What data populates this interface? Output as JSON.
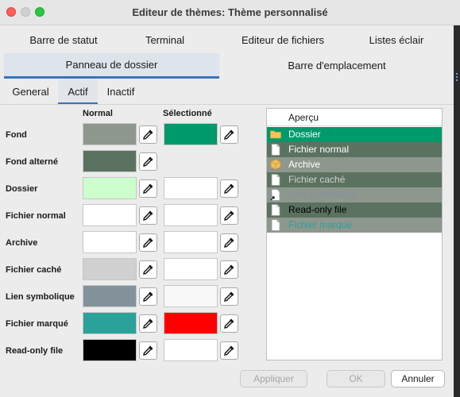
{
  "window": {
    "title": "Editeur de thèmes: Thème personnalisé"
  },
  "tabs_row1": [
    "Barre de statut",
    "Terminal",
    "Editeur de fichiers",
    "Listes éclair"
  ],
  "tabs_row2": [
    "Panneau de dossier",
    "Barre d'emplacement"
  ],
  "subtabs": [
    "General",
    "Actif",
    "Inactif"
  ],
  "columns": {
    "normal": "Normal",
    "selected": "Sélectionné"
  },
  "rows": [
    {
      "label": "Fond",
      "normal": "#8e978e",
      "selected": "#00996b"
    },
    {
      "label": "Fond alterné",
      "normal": "#5b7261",
      "selected": null
    },
    {
      "label": "Dossier",
      "normal": "#ccffcc",
      "selected": "#ffffff"
    },
    {
      "label": "Fichier normal",
      "normal": "#ffffff",
      "selected": "#ffffff"
    },
    {
      "label": "Archive",
      "normal": "#ffffff",
      "selected": "#ffffff"
    },
    {
      "label": "Fichier caché",
      "normal": "#d0d0d0",
      "selected": "#ffffff"
    },
    {
      "label": "Lien symbolique",
      "normal": "#83929a",
      "selected": "#f8f8f8"
    },
    {
      "label": "Fichier marqué",
      "normal": "#2aa29a",
      "selected": "#ff0000"
    },
    {
      "label": "Read-only file",
      "normal": "#000000",
      "selected": "#ffffff"
    }
  ],
  "preview": {
    "header": "Aperçu",
    "items": [
      {
        "label": "Dossier",
        "icon": "folder-icon",
        "bg": "#00996b",
        "fg": "#ffffff"
      },
      {
        "label": "Fichier normal",
        "icon": "file-icon",
        "bg": "#5b7261",
        "fg": "#ffffff"
      },
      {
        "label": "Archive",
        "icon": "archive-icon",
        "bg": "#8e978e",
        "fg": "#ffffff"
      },
      {
        "label": "Fichier caché",
        "icon": "file-icon",
        "bg": "#5b7261",
        "fg": "#d0d0d0"
      },
      {
        "label": "Lien symbolique",
        "icon": "symlink-icon",
        "bg": "#8e978e",
        "fg": "#83929a"
      },
      {
        "label": "Read-only file",
        "icon": "file-icon",
        "bg": "#5b7261",
        "fg": "#000000"
      },
      {
        "label": "Fichier marqué",
        "icon": "file-icon",
        "bg": "#8e978e",
        "fg": "#2aa29a"
      }
    ]
  },
  "buttons": {
    "apply": "Appliquer",
    "ok": "OK",
    "cancel": "Annuler"
  },
  "colors": {
    "accent": "#3b73b9",
    "tab_active_bg": "#dde4ec"
  }
}
